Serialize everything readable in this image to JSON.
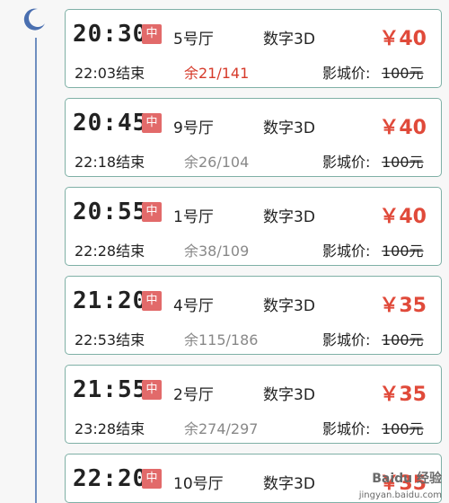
{
  "showtimes": [
    {
      "time": "20:30",
      "lang": "中",
      "hall": "5号厅",
      "format": "数字3D",
      "price": "￥40",
      "end": "22:03结束",
      "seats": "余21/141",
      "seats_hot": true,
      "orig_label": "影城价:",
      "orig_price": "100元"
    },
    {
      "time": "20:45",
      "lang": "中",
      "hall": "9号厅",
      "format": "数字3D",
      "price": "￥40",
      "end": "22:18结束",
      "seats": "余26/104",
      "seats_hot": false,
      "orig_label": "影城价:",
      "orig_price": "100元"
    },
    {
      "time": "20:55",
      "lang": "中",
      "hall": "1号厅",
      "format": "数字3D",
      "price": "￥40",
      "end": "22:28结束",
      "seats": "余38/109",
      "seats_hot": false,
      "orig_label": "影城价:",
      "orig_price": "100元"
    },
    {
      "time": "21:20",
      "lang": "中",
      "hall": "4号厅",
      "format": "数字3D",
      "price": "￥35",
      "end": "22:53结束",
      "seats": "余115/186",
      "seats_hot": false,
      "orig_label": "影城价:",
      "orig_price": "100元"
    },
    {
      "time": "21:55",
      "lang": "中",
      "hall": "2号厅",
      "format": "数字3D",
      "price": "￥35",
      "end": "23:28结束",
      "seats": "余274/297",
      "seats_hot": false,
      "orig_label": "影城价:",
      "orig_price": "100元"
    },
    {
      "time": "22:20",
      "lang": "中",
      "hall": "10号厅",
      "format": "数字3D",
      "price": "￥35",
      "end": "",
      "seats": "",
      "seats_hot": false,
      "orig_label": "",
      "orig_price": ""
    }
  ],
  "watermark": {
    "main": "Baidu 经验",
    "sub": "jingyan.baidu.com"
  },
  "colors": {
    "accent": "#e04a3a",
    "border": "#7fb0a6",
    "badge": "#e26a6a",
    "timeline": "#6f8fc0"
  },
  "icons": {
    "night": "moon-icon"
  }
}
